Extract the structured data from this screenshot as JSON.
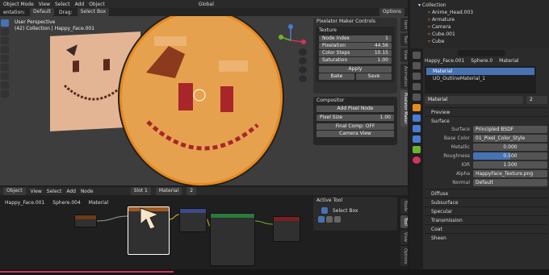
{
  "viewport": {
    "header_left": "entation:",
    "orientation": "Default",
    "drag_label": "Drag:",
    "drag_value": "Select Box",
    "mode": "Object Mode",
    "menus": [
      "View",
      "Select",
      "Add",
      "Object"
    ],
    "transform": "Global",
    "options_label": "Options",
    "overlay_title": "User Perspective",
    "overlay_sub": "(42) Collection | Happy_Face.001"
  },
  "pixelator": {
    "title": "Pixelator Maker Controls",
    "texture_title": "Texture",
    "fields": [
      {
        "label": "Node Index",
        "value": "1"
      },
      {
        "label": "Pixelation",
        "value": "44.56"
      },
      {
        "label": "Color Steps",
        "value": "10.15"
      },
      {
        "label": "Saturation",
        "value": "1.00"
      }
    ],
    "apply": "Apply",
    "bake": "Bake",
    "save": "Save",
    "compositor_title": "Compositor",
    "add_pixel_node": "Add Pixel Node",
    "pixel_size_label": "Pixel Size",
    "pixel_size_value": "1.00",
    "final_comp": "Final Comp: OFF",
    "camera_view": "Camera View"
  },
  "side_tabs": [
    "Item",
    "Tool",
    "View",
    "Animation",
    "Pixelator Maker"
  ],
  "outliner": {
    "root": "Collection",
    "items": [
      "Anime_Head.003",
      "Armature",
      "Camera",
      "Cube.001",
      "Cube"
    ]
  },
  "properties": {
    "search_placeholder": "",
    "breadcrumb": [
      "Happy_Face.001",
      "Sphere.0",
      "Material"
    ],
    "materials": [
      "Material",
      "UO_OutlineMaterial_1"
    ],
    "material_name": "Material",
    "slot_count": "2",
    "preview": "Preview",
    "surface_section": "Surface",
    "surface_label": "Surface",
    "surface_value": "Principled BSDF",
    "base_color_label": "Base Color",
    "base_color_value": "01_Pixel_Color_Style",
    "metallic_label": "Metallic",
    "metallic_value": "0.000",
    "roughness_label": "Roughness",
    "roughness_value": "0.500",
    "ior_label": "IOR",
    "ior_value": "1.500",
    "alpha_label": "Alpha",
    "alpha_value": "HappyFace_Texture.png",
    "normal_label": "Normal",
    "normal_value": "Default",
    "sections": [
      "Diffuse",
      "Subsurface",
      "Specular",
      "Transmission",
      "Coat",
      "Sheen"
    ]
  },
  "node_editor": {
    "editor": "Object",
    "menus": [
      "View",
      "Select",
      "Add",
      "Node"
    ],
    "slot": "Slot 1",
    "material": "Material",
    "users": "2",
    "breadcrumb": [
      "Happy_Face.001",
      "Sphere.004",
      "Material"
    ],
    "active_tool_title": "Active Tool",
    "select_box": "Select Box",
    "side_tabs": [
      "Node",
      "Tool",
      "View",
      "Options"
    ]
  },
  "colors": {
    "accent": "#4772b3",
    "ball": "#e7a24c",
    "timeline": "#d0345a"
  }
}
